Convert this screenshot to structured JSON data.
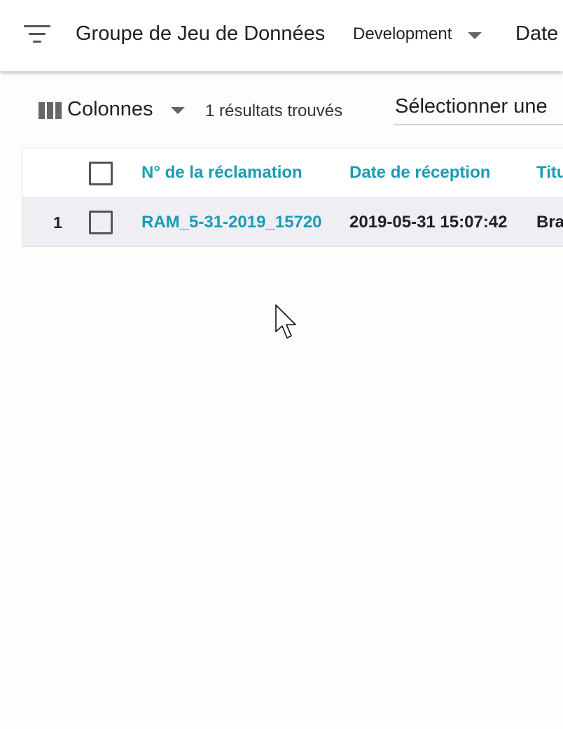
{
  "header": {
    "filter_icon": "filter-list-icon",
    "dataset_title": "Groupe de Jeu de Données",
    "environment": "Development",
    "date_label": "Date"
  },
  "toolbar": {
    "columns_icon": "view-column-icon",
    "columns_label": "Colonnes",
    "results": "1 résultats trouvés",
    "select_placeholder": "Sélectionner une"
  },
  "table": {
    "columns": [
      "N° de la réclamation",
      "Date de réception",
      "Titu"
    ],
    "rows": [
      {
        "index": "1",
        "claim_number": "RAM_5-31-2019_15720",
        "received_date": "2019-05-31 15:07:42",
        "holder": "Bra"
      }
    ]
  },
  "colors": {
    "accent": "#1a9bb5",
    "row_highlight": "#efeff3",
    "icon_gray": "#666666"
  }
}
